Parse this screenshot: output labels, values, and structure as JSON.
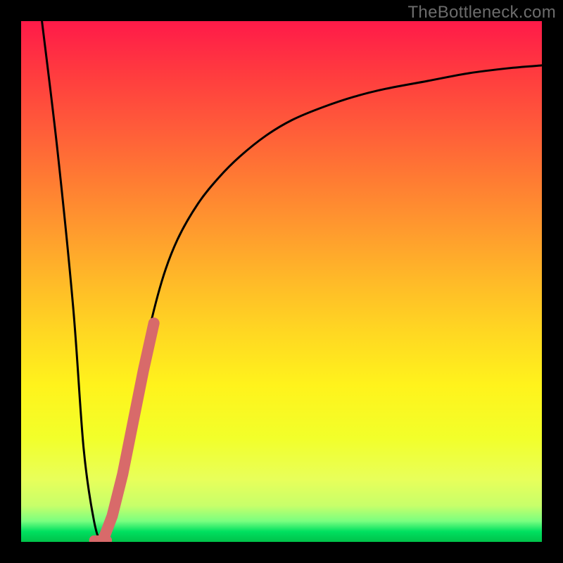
{
  "watermark": "TheBottleneck.com",
  "colors": {
    "curve_stroke": "#000000",
    "highlight_stroke": "#d86a6a",
    "gradient_top": "#ff1a49",
    "gradient_bottom": "#00c24a"
  },
  "chart_data": {
    "type": "line",
    "title": "",
    "xlabel": "",
    "ylabel": "",
    "xlim": [
      0,
      100
    ],
    "ylim": [
      0,
      100
    ],
    "grid": false,
    "legend": false,
    "series": [
      {
        "name": "bottleneck-curve",
        "note": "A V-shaped line that falls sharply to a minimum then rises along a log-like curve; y ≈ 0 at optimum, y ≈ 100 at extremes",
        "x": [
          4,
          7,
          10,
          12,
          14,
          15.5,
          17,
          19,
          21,
          24,
          27,
          30,
          34,
          38,
          42,
          47,
          52,
          58,
          64,
          70,
          78,
          86,
          94,
          100
        ],
        "y": [
          100,
          75,
          45,
          18,
          4,
          0,
          2,
          10,
          22,
          38,
          50,
          58,
          65,
          70,
          74,
          78,
          81,
          83.5,
          85.5,
          87,
          88.5,
          90,
          91,
          91.5
        ]
      },
      {
        "name": "highlight-segment",
        "note": "Thick salmon overlay on the rising limb near the minimum",
        "x": [
          15.8,
          17.5,
          19.5,
          21.5,
          23.5,
          25.5
        ],
        "y": [
          0.5,
          5,
          13,
          23,
          33,
          42
        ]
      },
      {
        "name": "minimum-marker",
        "note": "Short thick salmon dash marking the minimum point",
        "x": [
          14.0,
          16.5
        ],
        "y": [
          0.3,
          0.3
        ]
      }
    ]
  }
}
